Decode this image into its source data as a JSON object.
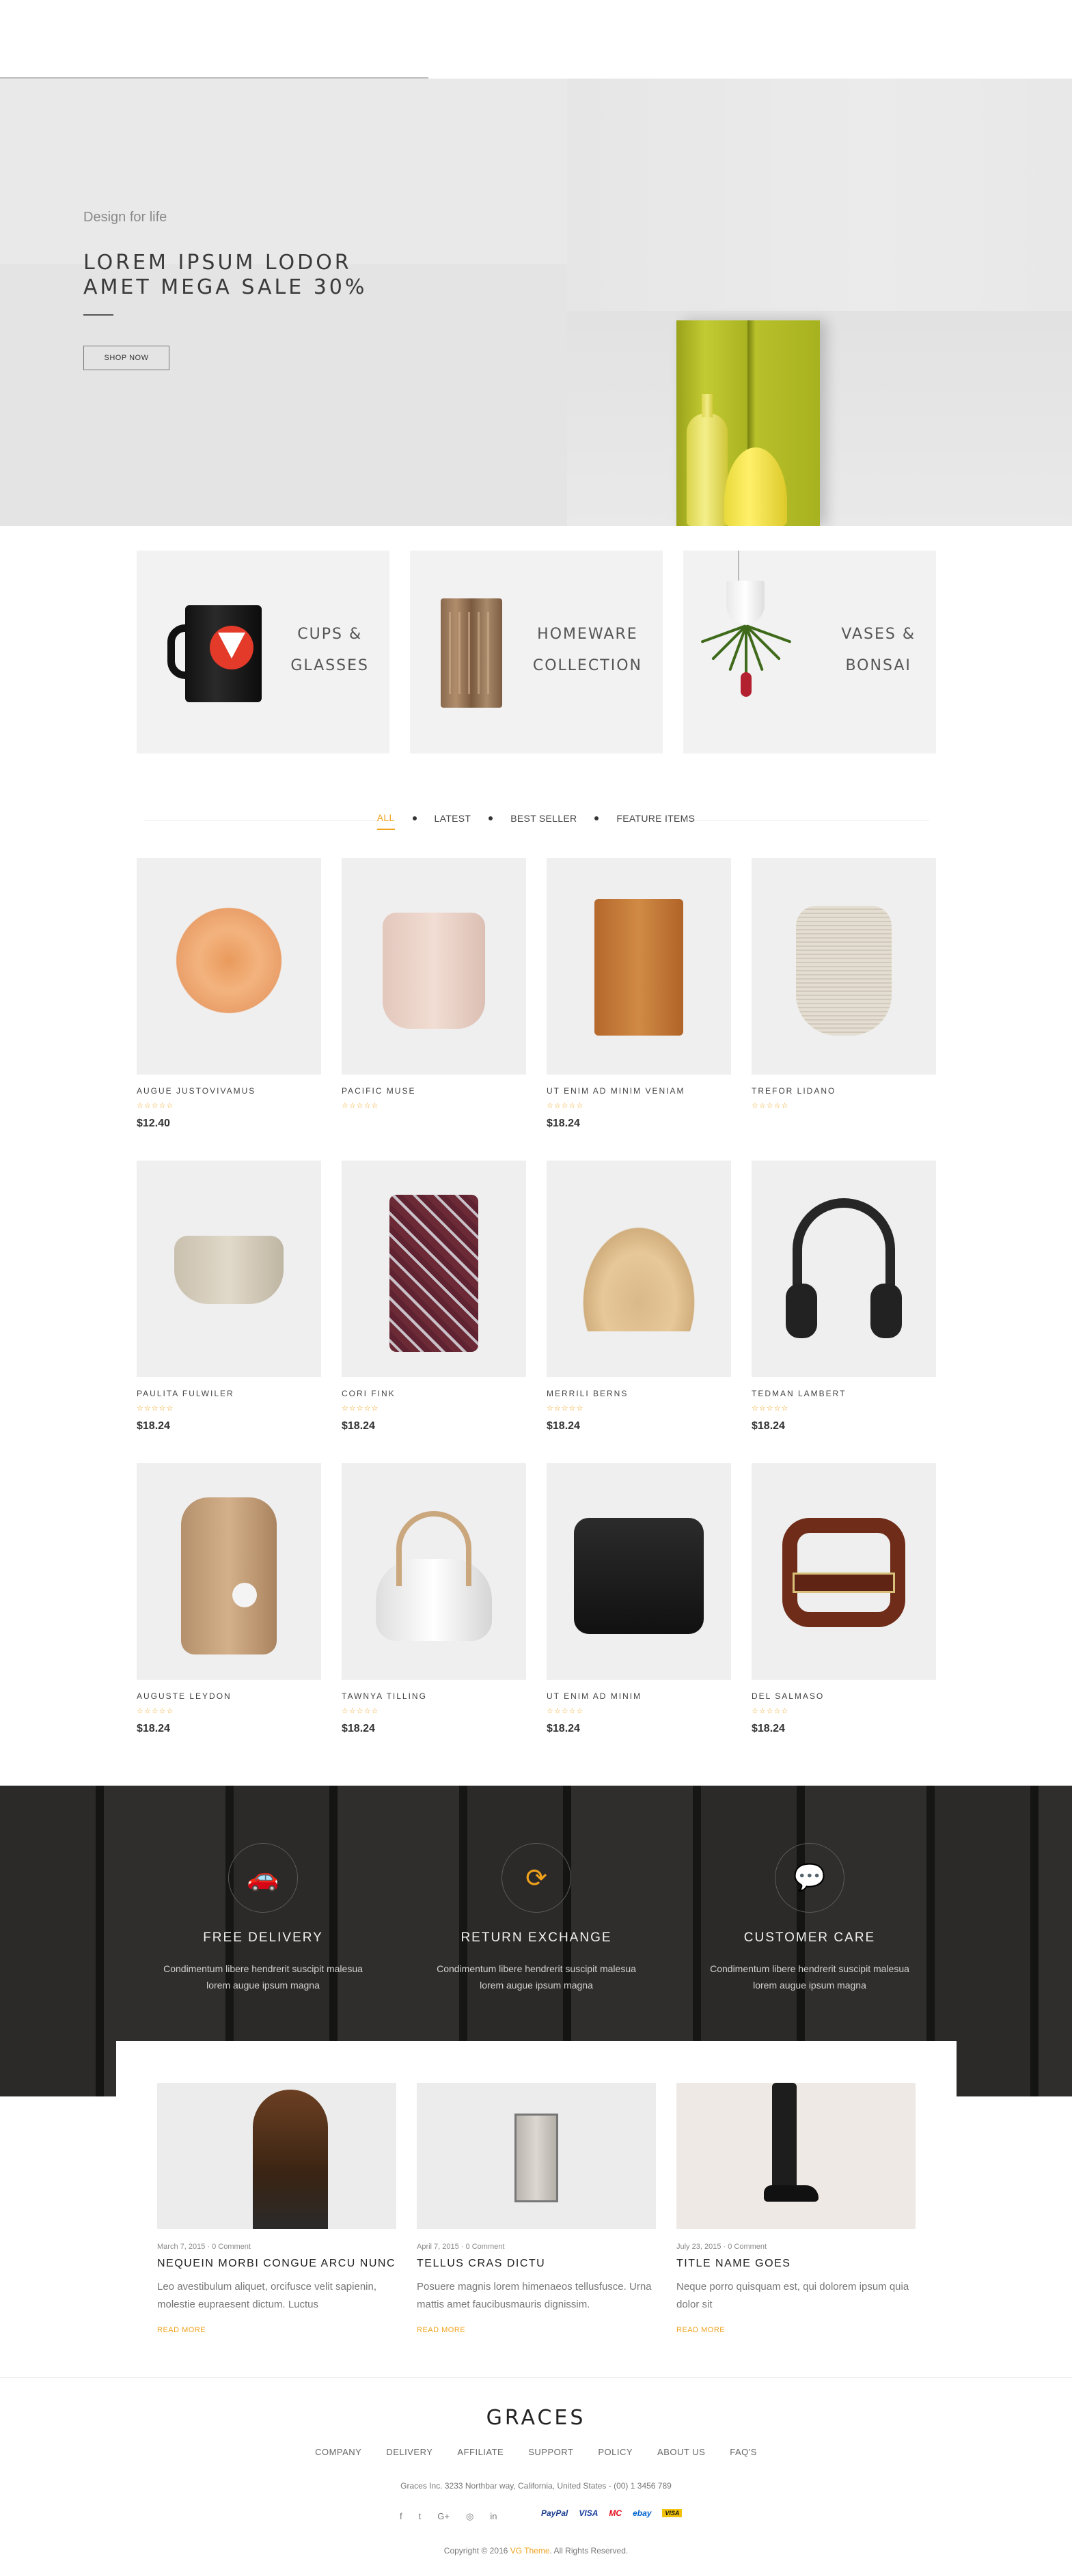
{
  "hero": {
    "subtitle": "Design for life",
    "title_line1": "LOREM IPSUM LODOR",
    "title_line2": "AMET MEGA SALE 30%",
    "button": "SHOP NOW",
    "slides": 3,
    "active_slide": 3
  },
  "categories": [
    {
      "line1": "CUPS &",
      "line2": "GLASSES"
    },
    {
      "line1": "HOMEWARE",
      "line2": "COLLECTION"
    },
    {
      "line1": "VASES &",
      "line2": "BONSAI"
    }
  ],
  "tabs": [
    "ALL",
    "LATEST",
    "BEST SELLER",
    "FEATURE ITEMS"
  ],
  "active_tab": "ALL",
  "products": [
    {
      "name": "AUGUE JUSTOVIVAMUS",
      "price": "$12.40",
      "rating": 0
    },
    {
      "name": "PACIFIC MUSE",
      "price": "",
      "rating": 0
    },
    {
      "name": "UT ENIM AD MINIM VENIAM",
      "price": "$18.24",
      "rating": 0
    },
    {
      "name": "TREFOR LIDANO",
      "price": "",
      "rating": 0
    },
    {
      "name": "PAULITA FULWILER",
      "price": "$18.24",
      "rating": 0
    },
    {
      "name": "CORI FINK",
      "price": "$18.24",
      "rating": 0
    },
    {
      "name": "MERRILI BERNS",
      "price": "$18.24",
      "rating": 0
    },
    {
      "name": "TEDMAN LAMBERT",
      "price": "$18.24",
      "rating": 0
    },
    {
      "name": "AUGUSTE LEYDON",
      "price": "$18.24",
      "rating": 0
    },
    {
      "name": "TAWNYA TILLING",
      "price": "$18.24",
      "rating": 0
    },
    {
      "name": "UT ENIM AD MINIM",
      "price": "$18.24",
      "rating": 0
    },
    {
      "name": "DEL SALMASO",
      "price": "$18.24",
      "rating": 0
    }
  ],
  "features": [
    {
      "icon": "car-icon",
      "title": "FREE DELIVERY",
      "line1": "Condimentum libere hendrerit suscipit malesua",
      "line2": "lorem augue ipsum magna"
    },
    {
      "icon": "refresh-icon",
      "title": "RETURN EXCHANGE",
      "line1": "Condimentum libere hendrerit suscipit malesua",
      "line2": "lorem augue ipsum magna"
    },
    {
      "icon": "chat-bubble-icon",
      "title": "CUSTOMER CARE",
      "line1": "Condimentum libere hendrerit suscipit malesua",
      "line2": "lorem augue ipsum magna"
    }
  ],
  "posts": [
    {
      "date": "March 7, 2015",
      "comments": "0 Comment",
      "title": "NEQUEIN MORBI CONGUE ARCU NUNC",
      "excerpt": "Leo avestibulum aliquet, orcifusce velit sapienin, molestie eupraesent dictum. Luctus",
      "readmore": "READ MORE"
    },
    {
      "date": "April 7, 2015",
      "comments": "0 Comment",
      "title": "TELLUS CRAS DICTU",
      "excerpt": "Posuere magnis lorem himenaeos tellusfusce. Urna mattis amet faucibusmauris dignissim.",
      "readmore": "READ MORE"
    },
    {
      "date": "July 23, 2015",
      "comments": "0 Comment",
      "title": "TITLE NAME GOES",
      "excerpt": "Neque porro quisquam est, qui dolorem ipsum quia dolor sit",
      "readmore": "READ MORE"
    }
  ],
  "footer": {
    "brand": "GRACES",
    "nav": [
      "COMPANY",
      "DELIVERY",
      "AFFILIATE",
      "SUPPORT",
      "POLICY",
      "ABOUT US",
      "FAQ'S"
    ],
    "address": "Graces Inc. 3233 Northbar way, California, United States - (00) 1 3456 789",
    "social": [
      "f",
      "t",
      "G+",
      "◎",
      "in"
    ],
    "payments": [
      "PayPal",
      "VISA",
      "MC",
      "ebay",
      "VISA"
    ],
    "copyright_prefix": "Copyright © 2016 ",
    "copyright_brand": "VG Theme",
    "copyright_suffix": ". All Rights Reserved."
  },
  "colors": {
    "accent": "#f0a21c",
    "dark_bg": "#2b2a28"
  }
}
